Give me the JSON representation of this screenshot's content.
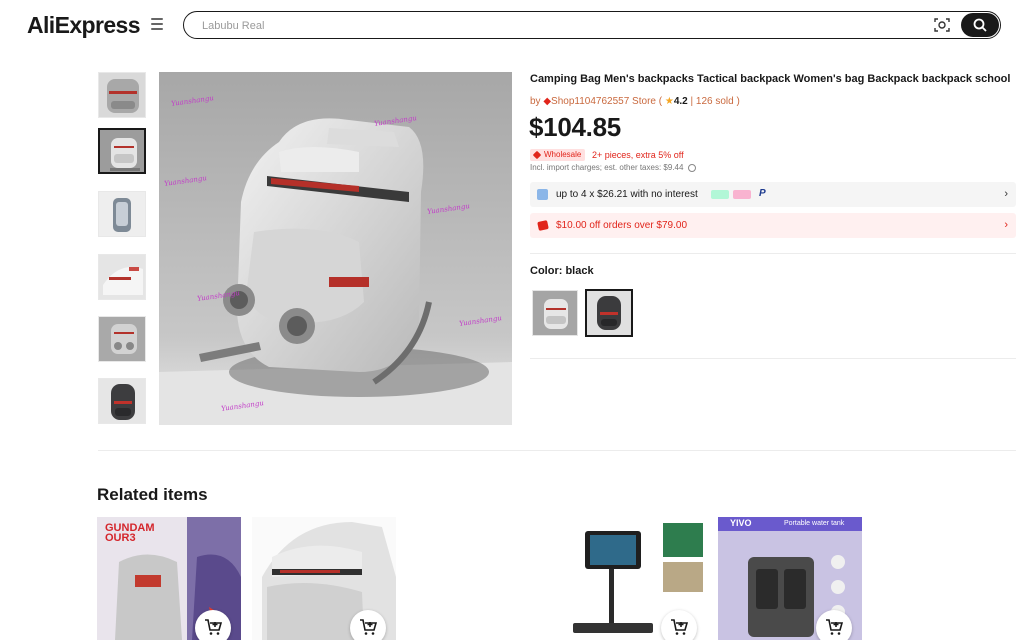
{
  "header": {
    "logo_text": "AliExpress",
    "search_placeholder": "Labubu Real",
    "menu_icon": "hamburger-menu-icon",
    "camera_icon": "image-search-icon",
    "search_icon": "search-icon"
  },
  "product": {
    "title": "Camping Bag Men's backpacks Tactical backpack Women's bag Backpack backpack school",
    "store_prefix": "by",
    "store_name": "Shop1104762557 Store",
    "rating": "4.2",
    "sold": "126 sold",
    "price": "$104.85",
    "wholesale_badge": "Wholesale",
    "wholesale_promo": "2+ pieces, extra 5% off",
    "taxes": "Incl. import charges; est. other taxes: $9.44",
    "installments": "up to 4 x $26.21 with no interest",
    "coupon": "$10.00 off orders over $79.00",
    "color_label": "Color:",
    "color_value": "black",
    "watermark": "Yuanshangu"
  },
  "related": {
    "title": "Related items",
    "cards": [
      "gundam-backpack",
      "white-backpack",
      "digital-microscope",
      "portable-water-tank"
    ],
    "card1_brand": "GUNDAM",
    "card1_sub": "OUR3",
    "card4_brand": "YIVO",
    "card4_banner": "Portable water tank"
  },
  "colors": {
    "brand_red": "#e1251b",
    "store_orange": "#c9693e",
    "text": "#191919"
  }
}
